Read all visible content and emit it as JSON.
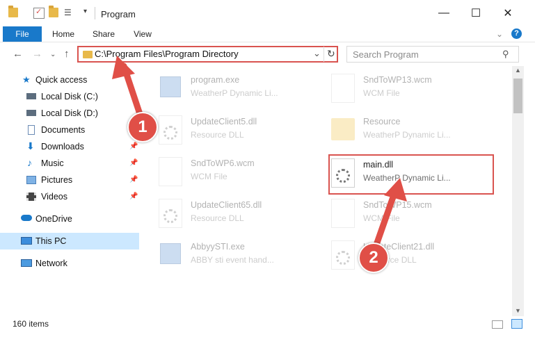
{
  "window": {
    "title": "Program",
    "minimize": "—",
    "maximize": "☐",
    "close": "✕"
  },
  "ribbon": {
    "tabs": [
      "File",
      "Home",
      "Share",
      "View"
    ],
    "expand": "⌄",
    "help": "?"
  },
  "address": {
    "path": "C:\\Program Files\\Program Directory",
    "dropdown": "⌄",
    "refresh": "↻"
  },
  "search": {
    "placeholder": "Search Program"
  },
  "nav": {
    "quick_access": "Quick access",
    "items": [
      {
        "label": "Local Disk (C:)",
        "icon": "drive-icon",
        "pinned": false
      },
      {
        "label": "Local Disk (D:)",
        "icon": "drive-icon",
        "pinned": false
      },
      {
        "label": "Documents",
        "icon": "documents-icon",
        "pinned": true
      },
      {
        "label": "Downloads",
        "icon": "downloads-icon",
        "pinned": true
      },
      {
        "label": "Music",
        "icon": "music-icon",
        "pinned": true
      },
      {
        "label": "Pictures",
        "icon": "pictures-icon",
        "pinned": true
      },
      {
        "label": "Videos",
        "icon": "videos-icon",
        "pinned": true
      }
    ],
    "onedrive": "OneDrive",
    "this_pc": "This PC",
    "network": "Network"
  },
  "files": [
    {
      "name": "program.exe",
      "desc": "WeatherP Dynamic Li...",
      "icon": "exe-icon"
    },
    {
      "name": "SndToWP13.wcm",
      "desc": "WCM File",
      "icon": "file-icon"
    },
    {
      "name": "UpdateClient5.dll",
      "desc": "Resource DLL",
      "icon": "dll-icon"
    },
    {
      "name": "Resource",
      "desc": "WeatherP Dynamic Li...",
      "icon": "folder-icon"
    },
    {
      "name": "SndToWP6.wcm",
      "desc": "WCM File",
      "icon": "file-icon"
    },
    {
      "name": "main.dll",
      "desc": "WeatherP Dynamic Li...",
      "icon": "dll-icon"
    },
    {
      "name": "UpdateClient65.dll",
      "desc": "Resource DLL",
      "icon": "dll-icon"
    },
    {
      "name": "SndToWP15.wcm",
      "desc": "WCM File",
      "icon": "file-icon"
    },
    {
      "name": "AbbyySTI.exe",
      "desc": "ABBY sti event hand...",
      "icon": "exe-icon"
    },
    {
      "name": "UpdateClient21.dll",
      "desc": "Resource DLL",
      "icon": "dll-icon"
    }
  ],
  "status": {
    "count": "160 items"
  },
  "annotations": {
    "step1": "1",
    "step2": "2",
    "color": "#e04f47"
  }
}
